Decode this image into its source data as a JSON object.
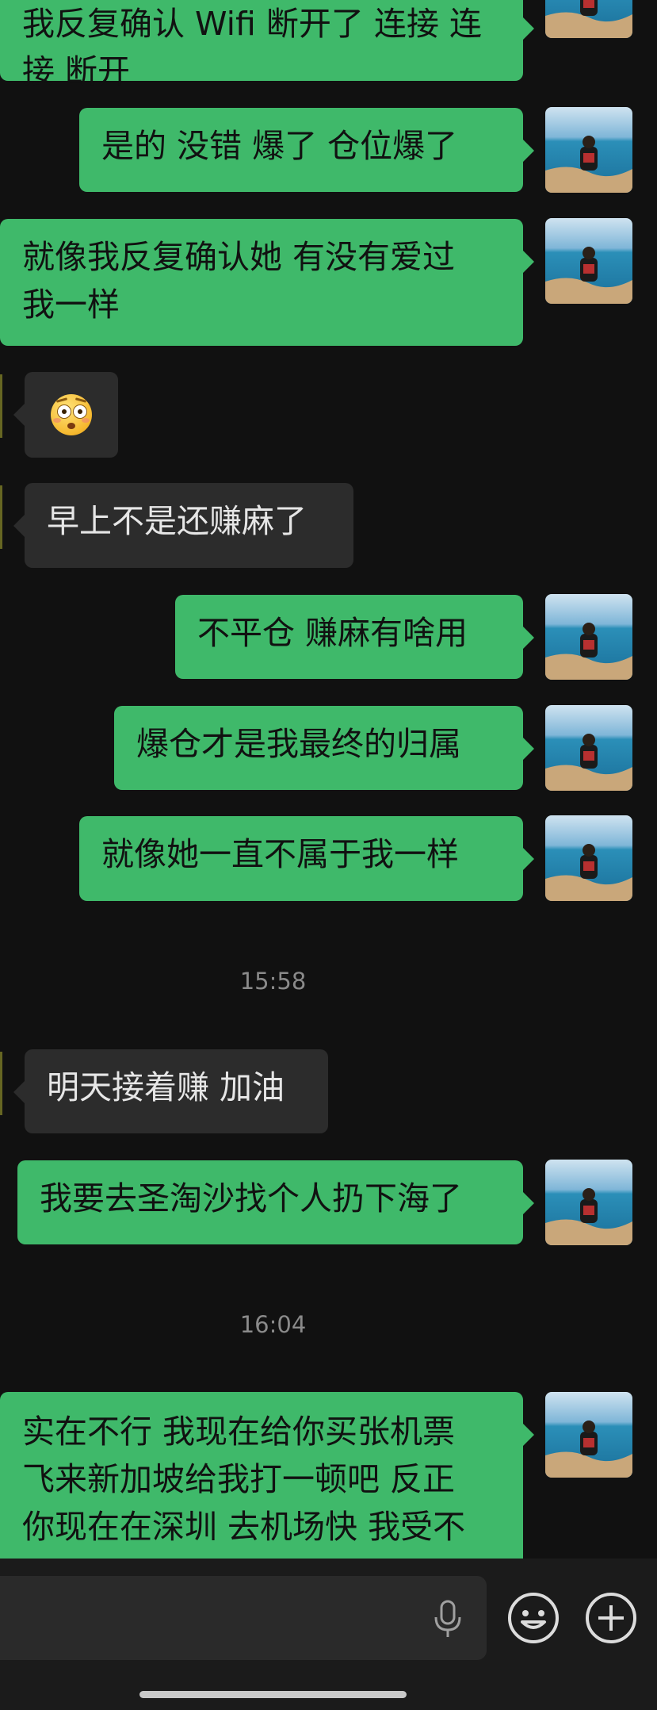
{
  "conversation": {
    "messages": [
      {
        "side": "right",
        "text_lines": [
          "我反复确认 Wifi 断开了 连接 连",
          "接 断开"
        ]
      },
      {
        "side": "right",
        "text_lines": [
          "是的 没错  爆了 仓位爆了"
        ]
      },
      {
        "side": "right",
        "text_lines": [
          "就像我反复确认她 有没有爱过",
          "我一样"
        ]
      },
      {
        "side": "left",
        "emoji": "flushed-face"
      },
      {
        "side": "left",
        "text_lines": [
          "早上不是还赚麻了"
        ]
      },
      {
        "side": "right",
        "text_lines": [
          "不平仓 赚麻有啥用"
        ]
      },
      {
        "side": "right",
        "text_lines": [
          "爆仓才是我最终的归属"
        ]
      },
      {
        "side": "right",
        "text_lines": [
          "就像她一直不属于我一样"
        ]
      },
      {
        "side": "left",
        "text_lines": [
          "明天接着赚 加油"
        ]
      },
      {
        "side": "right",
        "text_lines": [
          "我要去圣淘沙找个人扔下海了"
        ]
      },
      {
        "side": "right",
        "text_lines": [
          "实在不行 我现在给你买张机票",
          "飞来新加坡给我打一顿吧 反正",
          "你现在在深圳 去机场快   我受不"
        ]
      }
    ],
    "timestamps": [
      "15:58",
      "16:04"
    ]
  },
  "composer": {
    "voice_icon": "microphone-icon",
    "emoji_icon": "smiley-icon",
    "more_icon": "plus-circle-icon"
  },
  "colors": {
    "background": "#111111",
    "outgoing_bubble": "#3fb96a",
    "incoming_bubble": "#2c2c2c",
    "timestamp_text": "#8a8a8a"
  }
}
